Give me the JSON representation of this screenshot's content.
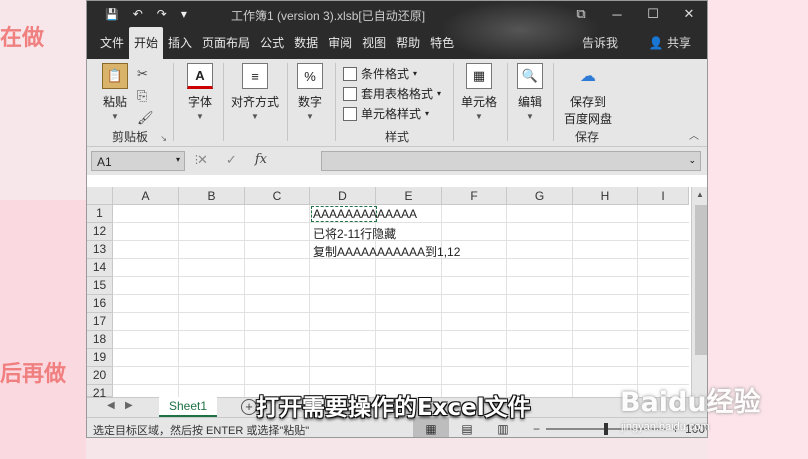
{
  "window": {
    "title": "工作簿1 (version 3).xlsb[已自动还原]",
    "controls": {
      "minimize": "─",
      "maximize": "☐",
      "close": "✕",
      "restore": "⧉"
    }
  },
  "quick_access": {
    "save": "💾",
    "undo": "↶",
    "redo": "↷",
    "customize": "▾"
  },
  "tabs": [
    {
      "label": "文件"
    },
    {
      "label": "开始"
    },
    {
      "label": "插入"
    },
    {
      "label": "页面布局"
    },
    {
      "label": "公式"
    },
    {
      "label": "数据"
    },
    {
      "label": "审阅"
    },
    {
      "label": "视图"
    },
    {
      "label": "帮助"
    },
    {
      "label": "特色"
    }
  ],
  "tell_me": "告诉我",
  "share": "共享",
  "ribbon": {
    "clipboard": {
      "paste": "粘贴",
      "group": "剪贴板"
    },
    "font": "字体",
    "alignment": "对齐方式",
    "number": "数字",
    "styles": {
      "conditional": "条件格式",
      "table": "套用表格格式",
      "cell": "单元格样式",
      "group": "样式"
    },
    "cells": "单元格",
    "editing": "编辑",
    "save": {
      "label_line1": "保存到",
      "label_line2": "百度网盘",
      "group": "保存"
    }
  },
  "formula_bar": {
    "name_box": "A1",
    "fx": "fx",
    "cancel": "✕",
    "enter": "✓",
    "value": ""
  },
  "columns": [
    "A",
    "B",
    "C",
    "D",
    "E",
    "F",
    "G",
    "H",
    "I"
  ],
  "rows": [
    "1",
    "12",
    "13",
    "14",
    "15",
    "16",
    "17",
    "18",
    "19",
    "20",
    "21"
  ],
  "cells": {
    "d1": "AAAAAAAAAAAAA",
    "d12": "已将2-11行隐藏",
    "d13": "复制AAAAAAAAAAA到1,12"
  },
  "sheets": [
    {
      "name": "Sheet1",
      "active": true
    }
  ],
  "status": {
    "message": "选定目标区域，然后按 ENTER 或选择\"粘贴\"",
    "zoom_percent": "100%",
    "zoom_level": 1.0
  },
  "overlay": {
    "subtitle": "打开需要操作的Excel文件",
    "watermark": "Baidu经验",
    "watermark_url": "jingyan.baidu.com"
  },
  "background": {
    "left_top_text": "在做",
    "left_bottom_text": "后再做"
  }
}
